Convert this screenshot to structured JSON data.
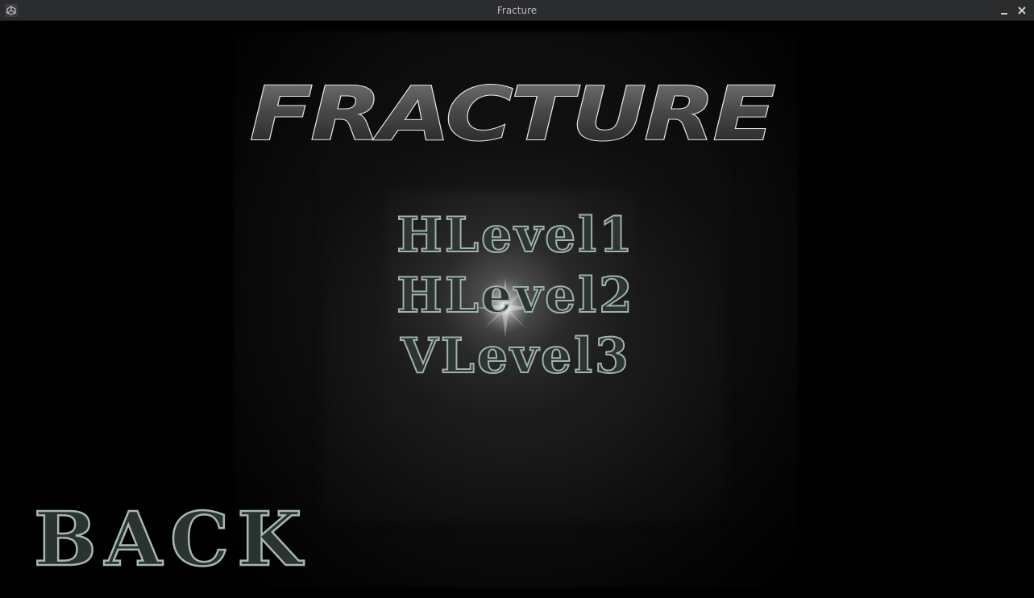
{
  "window": {
    "title": "Fracture",
    "icons": {
      "app": "unity-logo-icon",
      "minimize": "minimize-icon",
      "close": "close-icon"
    }
  },
  "game": {
    "logo_text": "FRACTURE",
    "levels": [
      {
        "label": "HLevel1"
      },
      {
        "label": "HLevel2"
      },
      {
        "label": "VLevel3"
      }
    ],
    "back_label": "BACK",
    "colors": {
      "background": "#000000",
      "titlebar": "#2b2c2e",
      "text_fill": "#2c3532",
      "text_outline": "#9fb3ab",
      "logo_fill": "#4a4a4a",
      "logo_outline": "#e6e6e6"
    }
  }
}
